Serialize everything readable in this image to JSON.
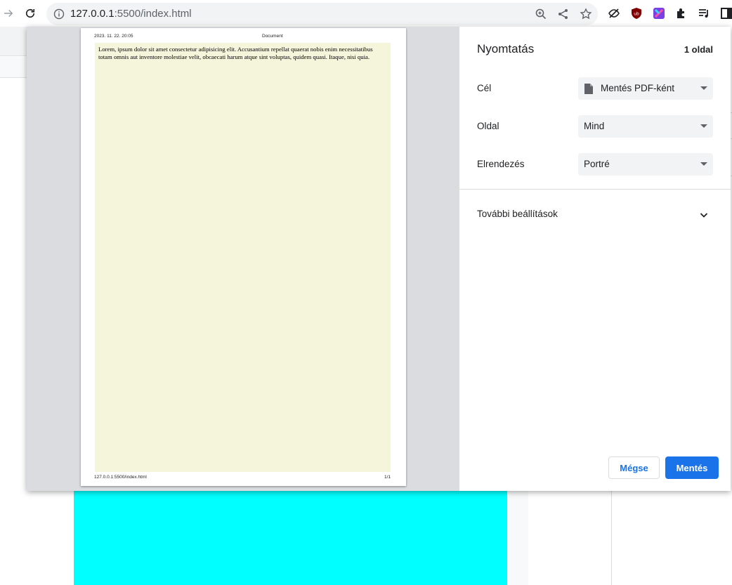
{
  "browser": {
    "url_host": "127.0.0.1",
    "url_rest": ":5500/index.html"
  },
  "print_dialog": {
    "title": "Nyomtatás",
    "page_count": "1 oldal",
    "destination": {
      "label": "Cél",
      "value": "Mentés PDF-ként"
    },
    "pages": {
      "label": "Oldal",
      "value": "Mind"
    },
    "layout": {
      "label": "Elrendezés",
      "value": "Portré"
    },
    "more_settings": "További beállítások",
    "cancel_label": "Mégse",
    "save_label": "Mentés"
  },
  "preview": {
    "header_date": "2023. 11. 22. 20:05",
    "header_title": "Document",
    "body_text": "Lorem, ipsum dolor sit amet consectetur adipisicing elit. Accusantium repellat quaerat nobis enim necessitatibus totam omnis aut inventore molestiae velit, obcaecati harum atque sint voluptas, quidem quasi. Itaque, nisi quia.",
    "footer_url": "127.0.0.1:5500/index.html",
    "footer_page": "1/1"
  },
  "colors": {
    "accent": "#1a73e8",
    "page_background": "#f5f5dc",
    "cyan_block": "#00ffff"
  }
}
